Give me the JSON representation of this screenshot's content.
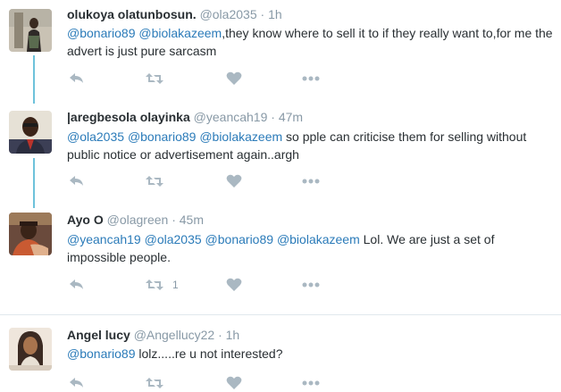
{
  "tweets": [
    {
      "name": "olukoya olatunbosun.",
      "handle": "@ola2035",
      "time": "1h",
      "text_parts": [
        {
          "t": "@bonario89",
          "m": true
        },
        {
          "t": " ",
          "m": false
        },
        {
          "t": "@biolakazeem",
          "m": true
        },
        {
          "t": ",they know where to sell it to if they really want to,for me the advert is just pure sarcasm",
          "m": false
        }
      ],
      "retweet_count": ""
    },
    {
      "name": "|aregbesola olayinka",
      "handle": "@yeancah19",
      "time": "47m",
      "text_parts": [
        {
          "t": "@ola2035",
          "m": true
        },
        {
          "t": " ",
          "m": false
        },
        {
          "t": "@bonario89",
          "m": true
        },
        {
          "t": " ",
          "m": false
        },
        {
          "t": "@biolakazeem",
          "m": true
        },
        {
          "t": "  so pple can criticise them for selling without public notice or advertisement again..argh",
          "m": false
        }
      ],
      "retweet_count": ""
    },
    {
      "name": "Ayo O",
      "handle": "@olagreen",
      "time": "45m",
      "text_parts": [
        {
          "t": "@yeancah19",
          "m": true
        },
        {
          "t": " ",
          "m": false
        },
        {
          "t": "@ola2035",
          "m": true
        },
        {
          "t": " ",
          "m": false
        },
        {
          "t": "@bonario89",
          "m": true
        },
        {
          "t": " ",
          "m": false
        },
        {
          "t": "@biolakazeem",
          "m": true
        },
        {
          "t": " Lol. We are just a set of impossible people.",
          "m": false
        }
      ],
      "retweet_count": "1"
    },
    {
      "name": "Angel lucy",
      "handle": "@Angellucy22",
      "time": "1h",
      "text_parts": [
        {
          "t": "@bonario89",
          "m": true
        },
        {
          "t": " lolz.....re u not interested?",
          "m": false
        }
      ],
      "retweet_count": ""
    }
  ],
  "colors": {
    "mention": "#2b7bb9",
    "thread_line": "#6ec2db",
    "icon": "#aab8c2"
  },
  "icons": [
    "reply-icon",
    "retweet-icon",
    "like-icon",
    "more-icon"
  ]
}
